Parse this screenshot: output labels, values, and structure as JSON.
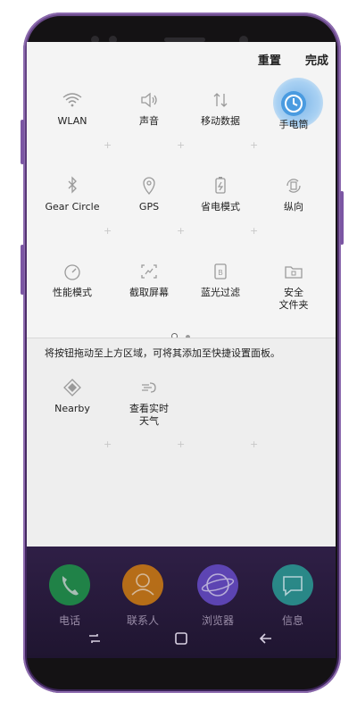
{
  "header": {
    "reset_label": "重置",
    "done_label": "完成"
  },
  "quick_tiles": [
    {
      "label": "WLAN",
      "icon": "wifi-icon"
    },
    {
      "label": "声音",
      "icon": "sound-icon"
    },
    {
      "label": "移动数据",
      "icon": "mobile-data-icon"
    },
    {
      "label": "手电筒",
      "icon": "flashlight-icon",
      "highlighted": true
    },
    {
      "label": "Gear Circle",
      "icon": "bluetooth-icon"
    },
    {
      "label": "GPS",
      "icon": "location-icon"
    },
    {
      "label": "省电模式",
      "icon": "battery-saver-icon"
    },
    {
      "label": "纵向",
      "icon": "rotation-icon"
    },
    {
      "label": "性能模式",
      "icon": "performance-icon"
    },
    {
      "label": "截取屏幕",
      "icon": "screenshot-icon"
    },
    {
      "label": "蓝光过滤",
      "icon": "blue-light-icon"
    },
    {
      "label": "安全\n文件夹",
      "icon": "secure-folder-icon"
    }
  ],
  "pager": {
    "page_count": 2,
    "active_page": 1
  },
  "drawer": {
    "hint": "将按钮拖动至上方区域，可将其添加至快捷设置面板。",
    "tiles": [
      {
        "label": "Nearby",
        "icon": "nearby-icon"
      },
      {
        "label": "查看实时\n天气",
        "icon": "weather-icon"
      }
    ]
  },
  "dock": {
    "apps": [
      {
        "label": "电话",
        "icon": "phone-icon",
        "color": "#1e9c4a"
      },
      {
        "label": "联系人",
        "icon": "contacts-icon",
        "color": "#d9820f"
      },
      {
        "label": "浏览器",
        "icon": "browser-icon",
        "color": "#6a4fd0"
      },
      {
        "label": "信息",
        "icon": "messages-icon",
        "color": "#2aa39a"
      }
    ]
  },
  "colors": {
    "accent_glow": "#7eb6e8",
    "device": "#5a3a7a"
  }
}
